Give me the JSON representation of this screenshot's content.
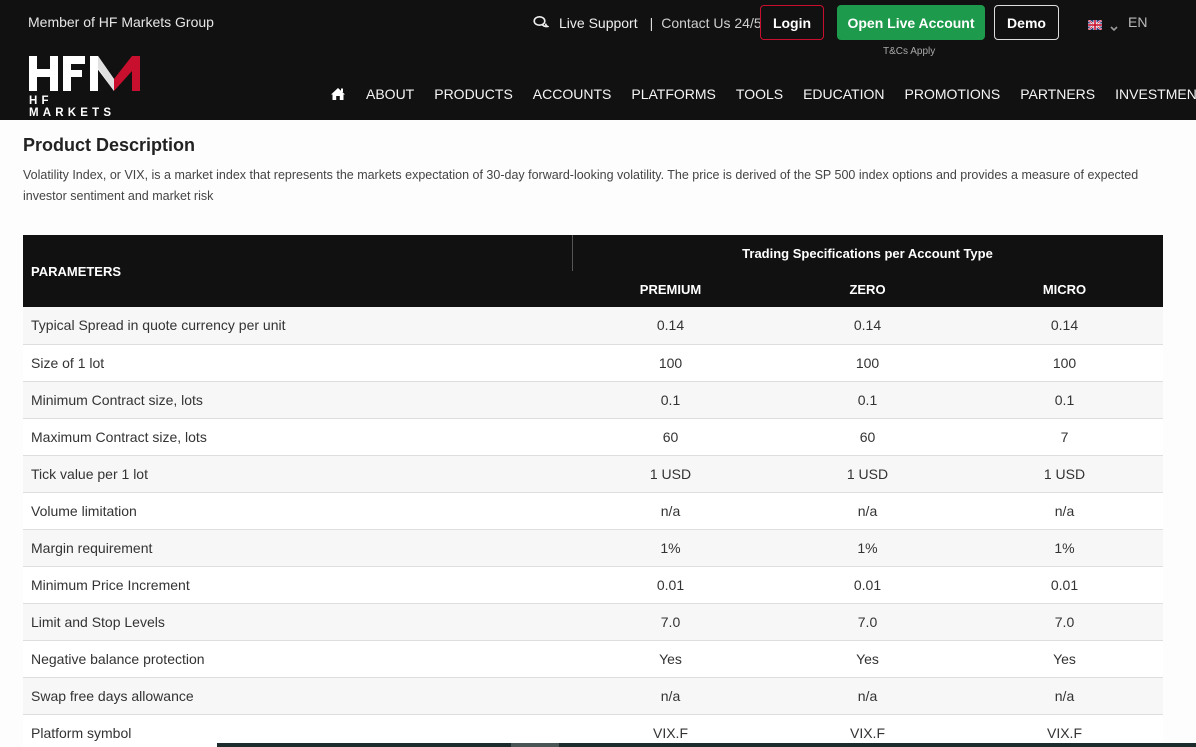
{
  "header": {
    "member_text": "Member of HF Markets Group",
    "live_support": "Live Support",
    "separator": "|",
    "contact": "Contact Us 24/5",
    "login": "Login",
    "open_live": "Open Live Account",
    "demo": "Demo",
    "tcs": "T&Cs Apply",
    "language": "EN",
    "logo_text": "HFM",
    "logo_subtitle": "HF MARKETS",
    "colors": {
      "brand_red": "#c8102e",
      "open_green": "#1d9a4b",
      "header_bg": "#111111"
    }
  },
  "nav": {
    "items": [
      "ABOUT",
      "PRODUCTS",
      "ACCOUNTS",
      "PLATFORMS",
      "TOOLS",
      "EDUCATION",
      "PROMOTIONS",
      "PARTNERS",
      "INVESTMENTS"
    ]
  },
  "product": {
    "title": "Product Description",
    "description": "Volatility Index, or VIX, is a market index that represents the markets expectation of 30-day forward-looking volatility. The price is derived of the SP 500 index options and provides a measure of expected investor sentiment and market risk"
  },
  "table": {
    "param_header": "PARAMETERS",
    "group_header": "Trading Specifications per Account Type",
    "columns": [
      "PREMIUM",
      "ZERO",
      "MICRO"
    ],
    "rows": [
      {
        "label": "Typical Spread in quote currency per unit",
        "values": [
          "0.14",
          "0.14",
          "0.14"
        ]
      },
      {
        "label": "Size of 1 lot",
        "values": [
          "100",
          "100",
          "100"
        ]
      },
      {
        "label": "Minimum Contract size, lots",
        "values": [
          "0.1",
          "0.1",
          "0.1"
        ]
      },
      {
        "label": "Maximum Contract size, lots",
        "values": [
          "60",
          "60",
          "7"
        ]
      },
      {
        "label": "Tick value per 1 lot",
        "values": [
          "1 USD",
          "1 USD",
          "1 USD"
        ]
      },
      {
        "label": "Volume limitation",
        "values": [
          "n/a",
          "n/a",
          "n/a"
        ]
      },
      {
        "label": "Margin requirement",
        "values": [
          "1%",
          "1%",
          "1%"
        ]
      },
      {
        "label": "Minimum Price Increment",
        "values": [
          "0.01",
          "0.01",
          "0.01"
        ]
      },
      {
        "label": "Limit and Stop Levels",
        "values": [
          "7.0",
          "7.0",
          "7.0"
        ]
      },
      {
        "label": "Negative balance protection",
        "values": [
          "Yes",
          "Yes",
          "Yes"
        ]
      },
      {
        "label": "Swap free days allowance",
        "values": [
          "n/a",
          "n/a",
          "n/a"
        ]
      },
      {
        "label": "Platform symbol",
        "values": [
          "VIX.F",
          "VIX.F",
          "VIX.F"
        ]
      }
    ]
  }
}
